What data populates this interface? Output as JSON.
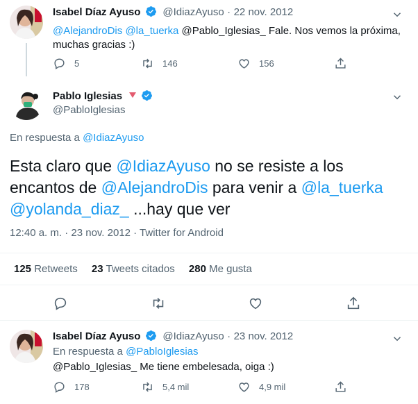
{
  "colors": {
    "link": "#1d9bf0",
    "muted": "#536471",
    "text": "#0f1419",
    "verified": "#1d9bf0",
    "divider": "#eff3f4"
  },
  "tweet1": {
    "name": "Isabel Díaz Ayuso",
    "handle": "@IdiazAyuso",
    "sep": "·",
    "date": "22 nov. 2012",
    "mention1": "@AlejandroDis",
    "mention2": "@la_tuerka",
    "text_rest": " @Pablo_Iglesias_ Fale. Nos vemos la próxima, muchas gracias :)",
    "replies": "5",
    "retweets": "146",
    "likes": "156"
  },
  "main": {
    "name": "Pablo Iglesias",
    "handle": "@PabloIglesias",
    "reply_prefix": "En respuesta a",
    "reply_to": "@IdiazAyuso",
    "text_a": "Esta claro que ",
    "mention_a": "@IdiazAyuso",
    "text_b": " no se resiste a los encantos de ",
    "mention_b": "@AlejandroDis",
    "text_c": " para venir a ",
    "mention_c": "@la_tuerka",
    "mention_d": "@yolanda_diaz_",
    "text_d": " ...hay que ver",
    "meta": "12:40 a. m. · 23 nov. 2012 · Twitter for Android",
    "stat1_num": "125",
    "stat1_label": "Retweets",
    "stat2_num": "23",
    "stat2_label": "Tweets citados",
    "stat3_num": "280",
    "stat3_label": "Me gusta"
  },
  "tweet3": {
    "name": "Isabel Díaz Ayuso",
    "handle": "@IdiazAyuso",
    "sep": "·",
    "date": "23 nov. 2012",
    "reply_prefix": "En respuesta a",
    "reply_to": "@PabloIglesias",
    "text": "@Pablo_Iglesias_ Me tiene embelesada, oiga :)",
    "replies": "178",
    "retweets": "5,4 mil",
    "likes": "4,9 mil"
  },
  "icons": [
    "reply-icon",
    "retweet-icon",
    "like-icon",
    "share-icon",
    "verified-icon",
    "more-icon",
    "triangle-badge-icon"
  ]
}
